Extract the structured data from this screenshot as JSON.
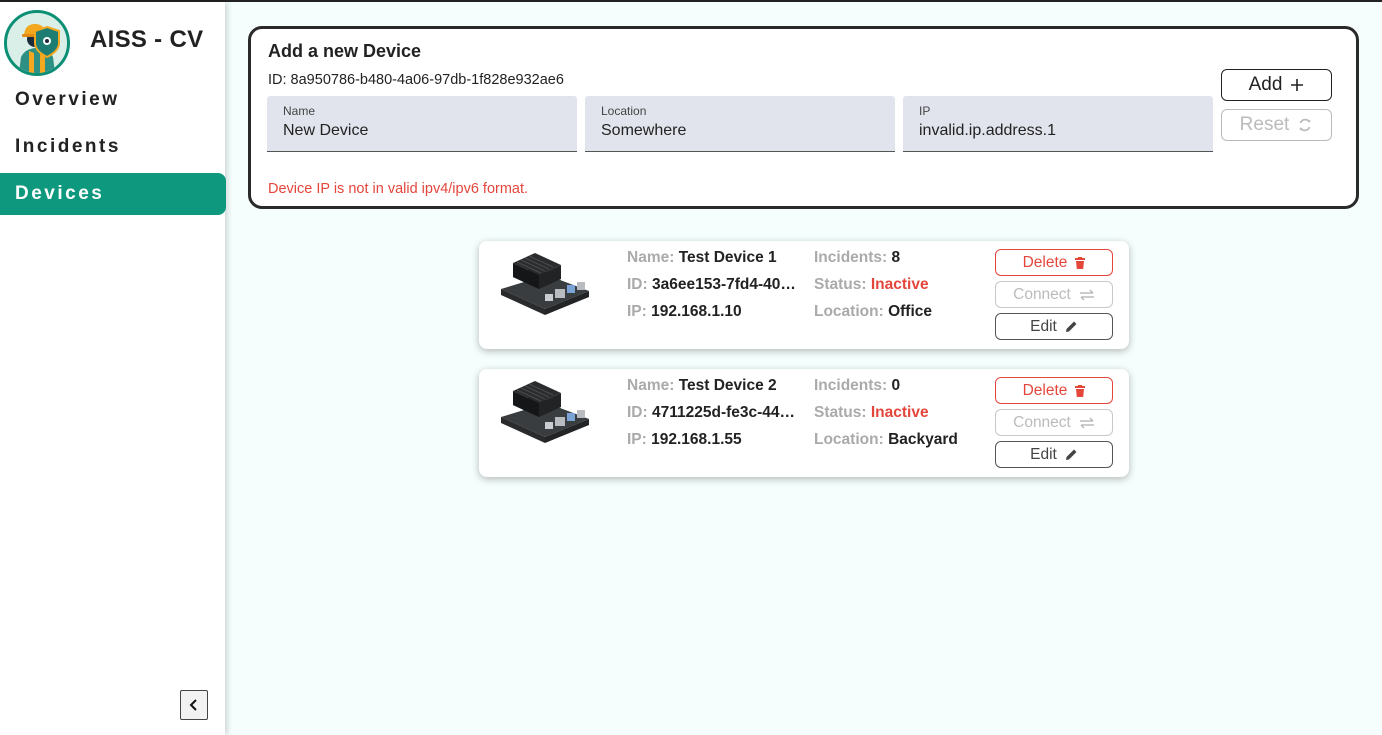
{
  "app": {
    "title": "AISS - CV",
    "logo_icon": "construction-worker-shield-icon"
  },
  "sidebar": {
    "items": [
      {
        "label": "Overview",
        "active": false
      },
      {
        "label": "Incidents",
        "active": false
      },
      {
        "label": "Devices",
        "active": true
      }
    ],
    "collapse_icon": "chevron-left-icon"
  },
  "add_device": {
    "title": "Add a new Device",
    "id_text": "ID: 8a950786-b480-4a06-97db-1f828e932ae6",
    "fields": [
      {
        "label": "Name",
        "value": "New Device"
      },
      {
        "label": "Location",
        "value": "Somewhere"
      },
      {
        "label": "IP",
        "value": "invalid.ip.address.1"
      }
    ],
    "error": "Device IP is not in valid ipv4/ipv6 format.",
    "add_label": "Add",
    "reset_label": "Reset"
  },
  "labels": {
    "name": "Name:",
    "id": "ID:",
    "ip": "IP:",
    "incidents": "Incidents:",
    "status": "Status:",
    "location": "Location:",
    "delete": "Delete",
    "connect": "Connect",
    "edit": "Edit"
  },
  "devices": [
    {
      "name": "Test Device 1",
      "id": "3a6ee153-7fd4-40…",
      "ip": "192.168.1.10",
      "incidents": "8",
      "status": "Inactive",
      "location": "Office"
    },
    {
      "name": "Test Device 2",
      "id": "4711225d-fe3c-44…",
      "ip": "192.168.1.55",
      "incidents": "0",
      "status": "Inactive",
      "location": "Backyard"
    }
  ],
  "colors": {
    "accent": "#0e987e",
    "error": "#e4463c",
    "field_bg": "#e1e4ed",
    "main_bg": "#f5fefd"
  }
}
